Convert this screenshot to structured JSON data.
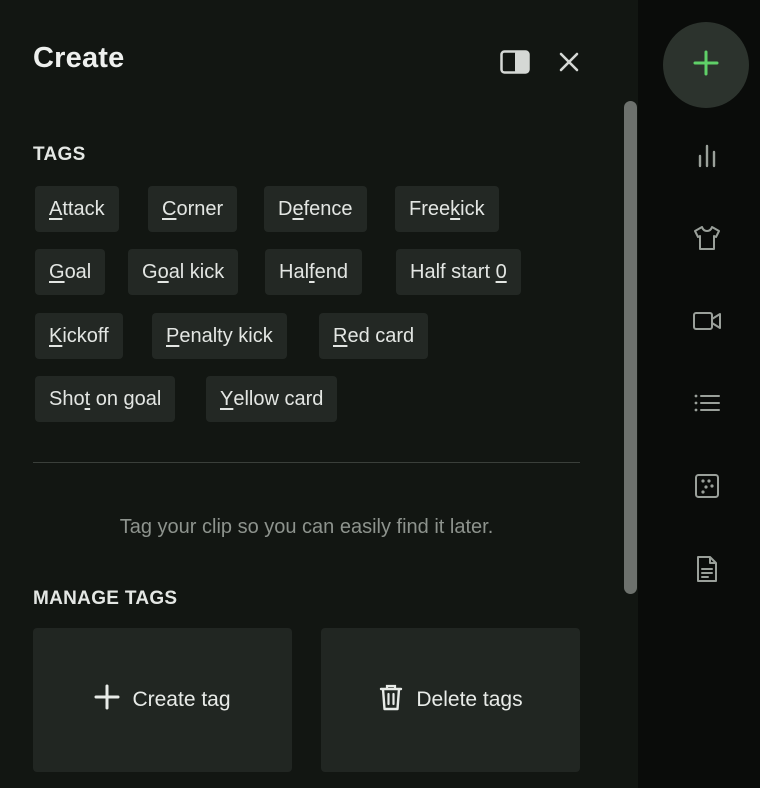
{
  "header": {
    "title": "Create"
  },
  "tags_section": {
    "label": "TAGS",
    "tags": [
      {
        "pre": "",
        "key": "A",
        "post": "ttack"
      },
      {
        "pre": "",
        "key": "C",
        "post": "orner"
      },
      {
        "pre": "D",
        "key": "e",
        "post": "fence"
      },
      {
        "pre": "Free",
        "key": "k",
        "post": "ick"
      },
      {
        "pre": "",
        "key": "G",
        "post": "oal"
      },
      {
        "pre": "G",
        "key": "o",
        "post": "al kick"
      },
      {
        "pre": "Hal",
        "key": "f",
        "post": " end"
      },
      {
        "pre": "Half start ",
        "key": "0",
        "post": ""
      },
      {
        "pre": "",
        "key": "K",
        "post": "ickoff"
      },
      {
        "pre": "",
        "key": "P",
        "post": "enalty kick"
      },
      {
        "pre": "",
        "key": "R",
        "post": "ed card"
      },
      {
        "pre": "Sho",
        "key": "t",
        "post": " on goal"
      },
      {
        "pre": "",
        "key": "Y",
        "post": "ellow card"
      }
    ]
  },
  "hint": "Tag your clip so you can easily find it later.",
  "manage": {
    "label": "MANAGE TAGS",
    "create_label": "Create tag",
    "delete_label": "Delete tags"
  },
  "rail": {
    "icons": [
      "plus-icon",
      "bar-chart-icon",
      "shirt-icon",
      "video-icon",
      "list-icon",
      "dice-icon",
      "document-icon"
    ],
    "accent": "#5fd068"
  }
}
